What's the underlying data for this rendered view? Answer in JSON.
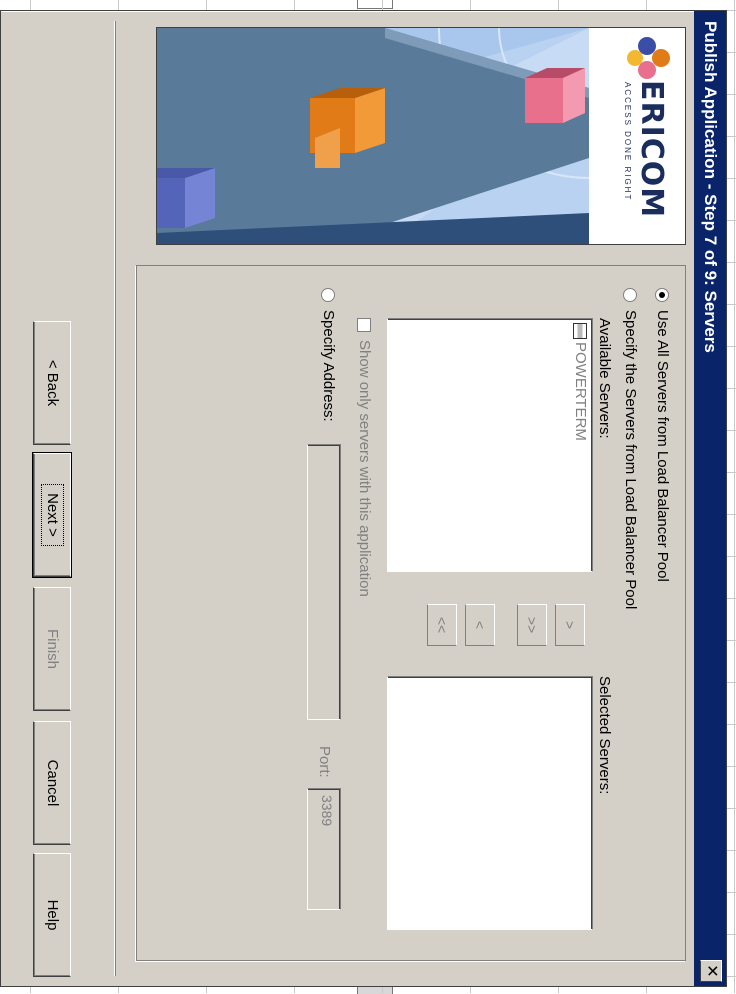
{
  "dialog": {
    "title": "Publish Application - Step 7 of 9: Servers",
    "close_label": "✕"
  },
  "banner": {
    "brand": "ERICOM",
    "tagline": "ACCESS DONE RIGHT"
  },
  "servers": {
    "option_all": "Use All Servers from Load Balancer Pool",
    "option_specify": "Specify the Servers from Load Balancer Pool",
    "available_label": "Available Servers:",
    "selected_label": "Selected Servers:",
    "available_servers": [
      "POWERTERM"
    ],
    "selected_servers": [],
    "move_right_label": ">",
    "move_all_right_label": ">>",
    "move_left_label": "<",
    "move_all_left_label": "<<",
    "filter_checkbox_label": "Show only servers with this application",
    "option_address": "Specify Address:",
    "address_value": "",
    "port_label": "Port:",
    "port_value": "3389",
    "selected_option": "all"
  },
  "buttons": {
    "back": "< Back",
    "next": "Next >",
    "finish": "Finish",
    "cancel": "Cancel",
    "help": "Help"
  },
  "colors": {
    "titlebar": "#0a246a",
    "dialog_face": "#d4d0c8",
    "logo_blue": "#1a2d5c",
    "cube_orange": "#e07b18",
    "cube_pink": "#e8708c",
    "cube_blue": "#5464b8"
  },
  "icons": {
    "server": "server-icon",
    "close": "close-icon"
  }
}
